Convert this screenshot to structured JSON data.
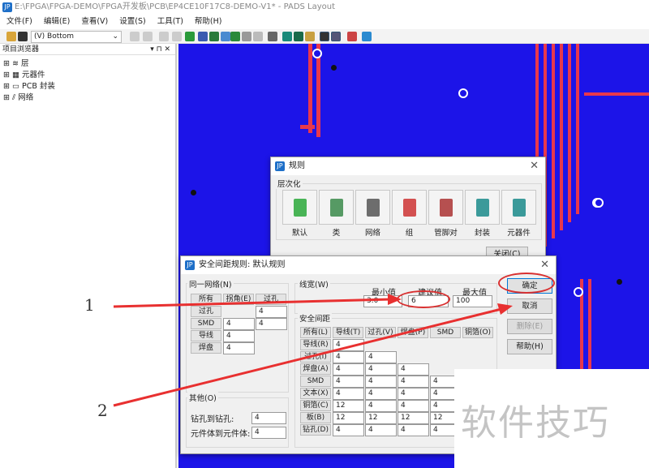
{
  "window": {
    "title": "E:\\FPGA\\FPGA-DEMO\\FPGA开发板\\PCB\\EP4CE10F17C8-DEMO-V1* - PADS Layout"
  },
  "menu": [
    "文件(F)",
    "编辑(E)",
    "查看(V)",
    "设置(S)",
    "工具(T)",
    "帮助(H)"
  ],
  "toolbar": {
    "layer": "(V) Bottom"
  },
  "project_browser": {
    "title": "项目浏览器",
    "items": [
      "层",
      "元器件",
      "PCB 封装",
      "网络"
    ]
  },
  "rules_dialog": {
    "title": "规则",
    "group": "层次化",
    "buttons": [
      "默认",
      "类",
      "网络",
      "组",
      "管脚对",
      "封装",
      "元器件"
    ],
    "close": "关闭(C)"
  },
  "clearance_dialog": {
    "title": "安全间距规则: 默认规则",
    "same_net": {
      "label": "同一网络(N)",
      "headers": [
        "所有",
        "拐角(E)",
        "过孔"
      ],
      "rows": [
        {
          "label": "过孔",
          "values": [
            "",
            "4"
          ]
        },
        {
          "label": "SMD",
          "values": [
            "4",
            "4"
          ]
        },
        {
          "label": "导线",
          "values": [
            "4"
          ]
        },
        {
          "label": "焊盘",
          "values": [
            "4"
          ]
        }
      ]
    },
    "width": {
      "label": "线宽(W)",
      "min_label": "最小值",
      "rec_label": "建议值",
      "max_label": "最大值",
      "min": "3.0",
      "rec": "6",
      "max": "100"
    },
    "clearance": {
      "label": "安全间距",
      "headers": [
        "所有(L)",
        "导线(T)",
        "过孔(V)",
        "焊盘(P)",
        "SMD",
        "铜箔(O)"
      ],
      "rows": [
        {
          "label": "导线(R)",
          "values": [
            "4"
          ]
        },
        {
          "label": "过孔(I)",
          "values": [
            "4",
            "4"
          ]
        },
        {
          "label": "焊盘(A)",
          "values": [
            "4",
            "4",
            "4"
          ]
        },
        {
          "label": "SMD",
          "values": [
            "4",
            "4",
            "4",
            "4"
          ]
        },
        {
          "label": "文本(X)",
          "values": [
            "4",
            "4",
            "4",
            "4"
          ]
        },
        {
          "label": "铜箔(C)",
          "values": [
            "12",
            "4",
            "4",
            "4"
          ]
        },
        {
          "label": "板(B)",
          "values": [
            "12",
            "12",
            "12",
            "12"
          ]
        },
        {
          "label": "钻孔(D)",
          "values": [
            "4",
            "4",
            "4",
            "4"
          ]
        }
      ]
    },
    "other": {
      "label": "其他(O)",
      "drill_label": "钻孔到钻孔:",
      "drill": "4",
      "body_label": "元件体到元件体:",
      "body": "4"
    },
    "buttons": {
      "ok": "确定",
      "cancel": "取消",
      "delete": "删除(E)",
      "help": "帮助(H)"
    }
  },
  "annotations": [
    "1",
    "2"
  ],
  "watermark": "软件技巧",
  "colors": {
    "board": "#1c14e8",
    "trace": "#e8384c",
    "arrow": "#e83030"
  }
}
